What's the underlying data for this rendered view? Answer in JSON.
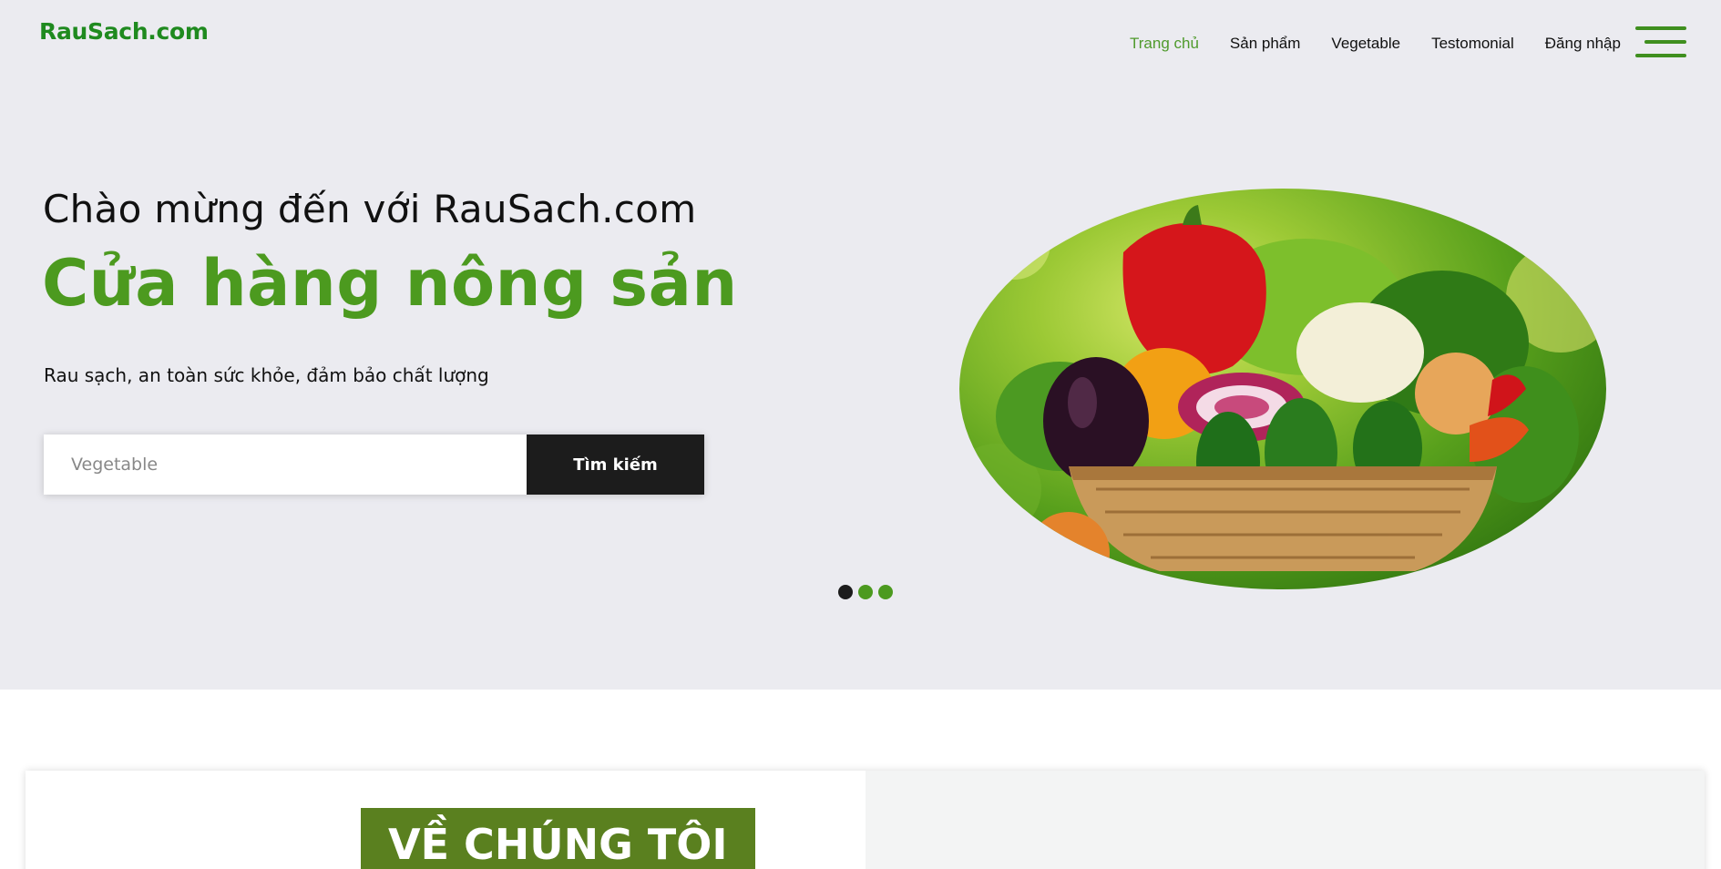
{
  "brand": {
    "logo": "RauSach.com"
  },
  "nav": {
    "items": [
      {
        "label": "Trang chủ",
        "active": true
      },
      {
        "label": "Sản phẩm"
      },
      {
        "label": "Vegetable"
      },
      {
        "label": "Testomonial"
      },
      {
        "label": "Đăng nhập"
      }
    ],
    "menu_icon": "hamburger-menu-icon"
  },
  "hero": {
    "welcome": "Chào mừng đến với RauSach.com",
    "headline": "Cửa hàng nông sản",
    "tagline": "Rau sạch, an toàn sức khỏe, đảm bảo chất lượng",
    "search": {
      "placeholder": "Vegetable",
      "button_label": "Tìm kiếm"
    },
    "image": "vegetable-basket-image",
    "slider_dots": 3,
    "active_slide": 1
  },
  "about": {
    "title": "VỀ CHÚNG TÔI"
  },
  "colors": {
    "brand_green": "#4c9a1f",
    "logo_green": "#1f8a1f",
    "dark": "#1c1c1c",
    "hero_bg": "#ebebf0",
    "about_title_bg": "#5a801f"
  }
}
